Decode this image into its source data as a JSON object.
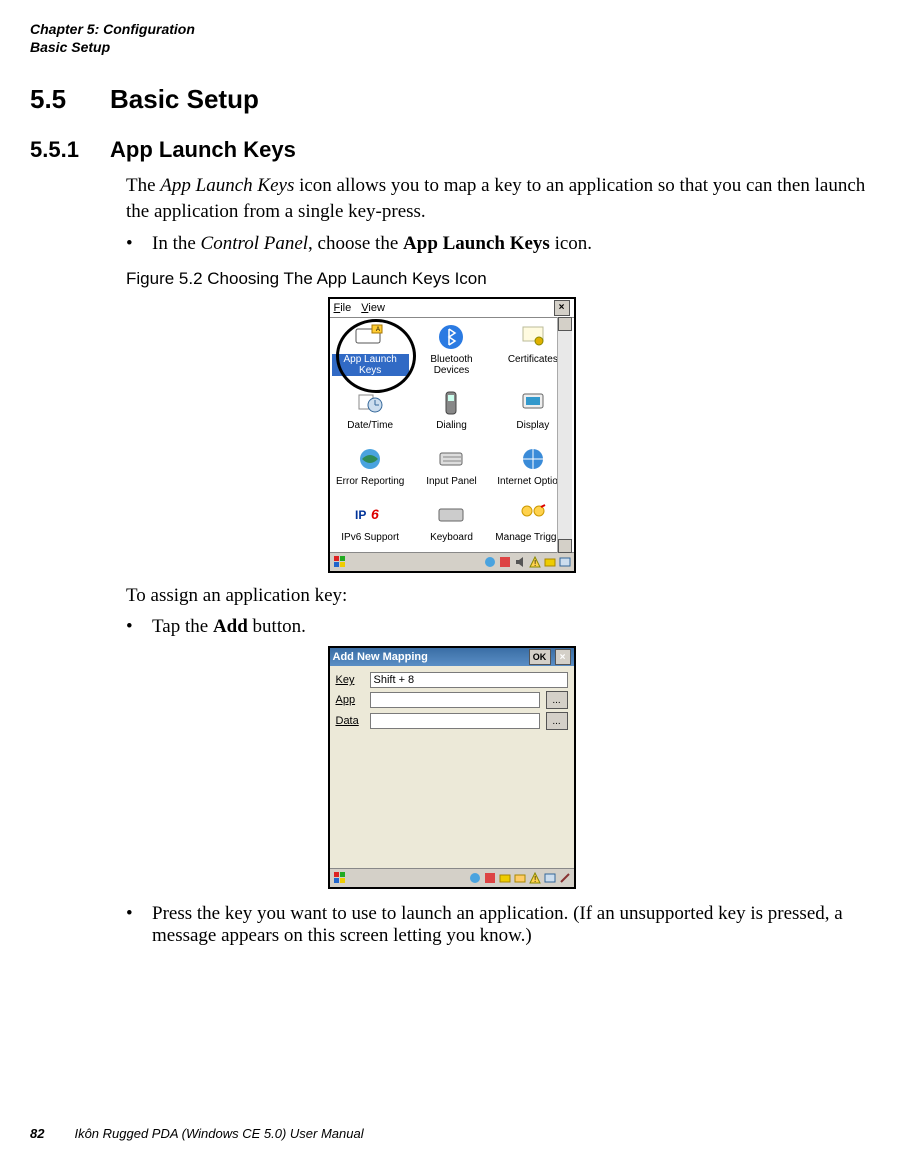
{
  "header": {
    "chapter_line1": "Chapter 5: Configuration",
    "chapter_line2": "Basic Setup"
  },
  "section_5_5": {
    "number": "5.5",
    "title": "Basic Setup"
  },
  "section_5_5_1": {
    "number": "5.5.1",
    "title": "App Launch Keys"
  },
  "para1_a": "The ",
  "para1_b_italic": "App Launch Keys",
  "para1_c": " icon allows you to map a key to an application so that you can then launch the application from a single key-press.",
  "bullet1_a": "In the ",
  "bullet1_b_italic": "Control Panel",
  "bullet1_c": ", choose the ",
  "bullet1_d_bold": "App Launch Keys",
  "bullet1_e": " icon.",
  "figure_caption": "Figure 5.2  Choosing The App Launch Keys Icon",
  "control_panel": {
    "menu_file": "File",
    "menu_view": "View",
    "close": "×",
    "icons": [
      {
        "label": "App Launch Keys",
        "selected": true,
        "icon": "keyboard-app-icon"
      },
      {
        "label": "Bluetooth Devices",
        "selected": false,
        "icon": "bluetooth-icon"
      },
      {
        "label": "Certificates",
        "selected": false,
        "icon": "certificate-icon"
      },
      {
        "label": "Date/Time",
        "selected": false,
        "icon": "datetime-icon"
      },
      {
        "label": "Dialing",
        "selected": false,
        "icon": "phone-icon"
      },
      {
        "label": "Display",
        "selected": false,
        "icon": "display-icon"
      },
      {
        "label": "Error Reporting",
        "selected": false,
        "icon": "globe-icon"
      },
      {
        "label": "Input Panel",
        "selected": false,
        "icon": "keyboard-icon"
      },
      {
        "label": "Internet Options",
        "selected": false,
        "icon": "internet-icon"
      },
      {
        "label": "IPv6 Support",
        "selected": false,
        "icon": "ipv6-icon"
      },
      {
        "label": "Keyboard",
        "selected": false,
        "icon": "keyboard2-icon"
      },
      {
        "label": "Manage Triggers",
        "selected": false,
        "icon": "triggers-icon"
      }
    ]
  },
  "para2": "To assign an application key:",
  "bullet2_a": "Tap the ",
  "bullet2_b_bold": "Add",
  "bullet2_c": " button.",
  "dialog": {
    "title": "Add New Mapping",
    "ok": "OK",
    "close": "×",
    "row_key_label": "Key",
    "row_key_value": "Shift + 8",
    "row_app_label": "App",
    "row_app_value": "",
    "row_data_label": "Data",
    "row_data_value": "",
    "browse": "..."
  },
  "bullet3": "Press the key you want to use to launch an application. (If an unsupported key is pressed, a message appears on this screen letting you know.)",
  "footer": {
    "page": "82",
    "title": "Ikôn Rugged PDA (Windows CE 5.0) User Manual"
  }
}
